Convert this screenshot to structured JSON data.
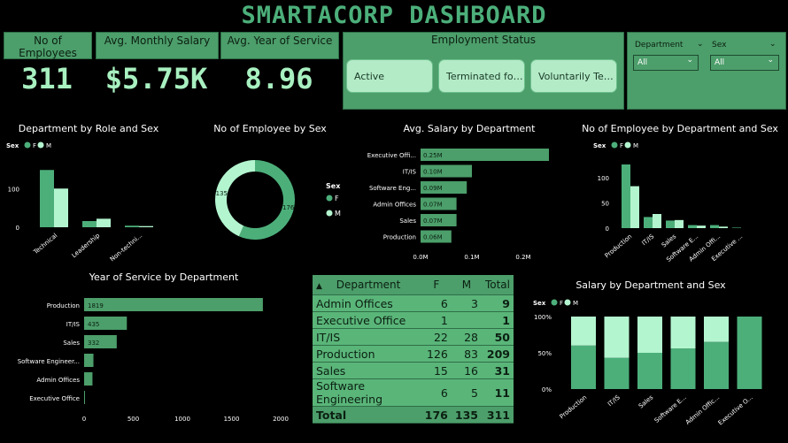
{
  "header": {
    "title": "SMARTACORP DASHBOARD"
  },
  "kpis": [
    {
      "label": "No of Employees",
      "value": "311"
    },
    {
      "label": "Avg. Monthly Salary",
      "value": "$5.75K"
    },
    {
      "label": "Avg. Year of Service",
      "value": "8.96"
    }
  ],
  "employment_status": {
    "title": "Employment Status",
    "options": [
      "Active",
      "Terminated for…",
      "Voluntarily Ter…"
    ]
  },
  "slicers": [
    {
      "label": "Department",
      "selected": "All"
    },
    {
      "label": "Sex",
      "selected": "All"
    }
  ],
  "colors": {
    "female": "#4caf7a",
    "male": "#b3f5cf",
    "bar": "#4c9e6a",
    "card": "#4c9e6a",
    "background": "#000000"
  },
  "chart_data": [
    {
      "id": "dept_role_sex",
      "type": "bar",
      "title": "Department by Role and Sex",
      "legend_title": "Sex",
      "legend": [
        "F",
        "M"
      ],
      "categories": [
        "Technical",
        "Leadership",
        "Non-techni..."
      ],
      "series": [
        {
          "name": "F",
          "values": [
            148,
            16,
            4
          ]
        },
        {
          "name": "M",
          "values": [
            100,
            22,
            3
          ]
        }
      ],
      "yticks": [
        "0",
        "100"
      ],
      "ylim": [
        0,
        160
      ]
    },
    {
      "id": "emp_by_sex",
      "type": "pie",
      "title": "No of Employee by Sex",
      "legend_title": "Sex",
      "legend": [
        "F",
        "M"
      ],
      "slices": [
        {
          "name": "F",
          "value": 176
        },
        {
          "name": "M",
          "value": 135
        }
      ]
    },
    {
      "id": "avg_salary_dept",
      "type": "bar",
      "orientation": "horizontal",
      "title": "Avg. Salary by Department",
      "categories": [
        "Executive Offi...",
        "IT/IS",
        "Software Eng...",
        "Admin Offices",
        "Sales",
        "Production"
      ],
      "values": [
        0.25,
        0.1,
        0.09,
        0.07,
        0.07,
        0.06
      ],
      "labels": [
        "0.25M",
        "0.10M",
        "0.09M",
        "0.07M",
        "0.07M",
        "0.06M"
      ],
      "xticks": [
        "0.0M",
        "0.1M",
        "0.2M"
      ],
      "xlim": [
        0,
        0.2
      ]
    },
    {
      "id": "emp_dept_sex",
      "type": "bar",
      "title": "No of Employee by Department and Sex",
      "legend_title": "Sex",
      "legend": [
        "F",
        "M"
      ],
      "categories": [
        "Production",
        "IT/IS",
        "Sales",
        "Software E...",
        "Admin Offi...",
        "Executive ..."
      ],
      "series": [
        {
          "name": "F",
          "values": [
            126,
            22,
            15,
            6,
            6,
            1
          ]
        },
        {
          "name": "M",
          "values": [
            83,
            28,
            16,
            5,
            3,
            0
          ]
        }
      ],
      "yticks": [
        "0",
        "50",
        "100"
      ],
      "ylim": [
        0,
        140
      ]
    },
    {
      "id": "yos_dept",
      "type": "bar",
      "orientation": "horizontal",
      "title": "Year of Service by Department",
      "categories": [
        "Production",
        "IT/IS",
        "Sales",
        "Software Engineer...",
        "Admin Offices",
        "Executive Office"
      ],
      "values": [
        1819,
        435,
        332,
        95,
        85,
        8
      ],
      "labels": [
        "1819",
        "435",
        "332",
        "",
        "",
        ""
      ],
      "xticks": [
        "0",
        "500",
        "1000",
        "1500",
        "2000"
      ],
      "xlim": [
        0,
        2000
      ]
    },
    {
      "id": "salary_dept_sex",
      "type": "bar",
      "stacked": "100%",
      "title": "Salary by Department and Sex",
      "legend_title": "Sex",
      "legend": [
        "F",
        "M"
      ],
      "categories": [
        "Production",
        "IT/IS",
        "Sales",
        "Software E...",
        "Admin Offic...",
        "Executive O..."
      ],
      "series": [
        {
          "name": "F",
          "values": [
            60,
            43,
            50,
            56,
            65,
            100
          ]
        },
        {
          "name": "M",
          "values": [
            40,
            57,
            50,
            44,
            35,
            0
          ]
        }
      ],
      "yticks": [
        "0%",
        "50%",
        "100%"
      ],
      "ylim": [
        0,
        100
      ]
    },
    {
      "id": "dept_matrix",
      "type": "table",
      "columns": [
        "Department",
        "F",
        "M",
        "Total"
      ],
      "rows": [
        [
          "Admin Offices",
          "6",
          "3",
          "9"
        ],
        [
          "Executive Office",
          "1",
          "",
          "1"
        ],
        [
          "IT/IS",
          "22",
          "28",
          "50"
        ],
        [
          "Production",
          "126",
          "83",
          "209"
        ],
        [
          "Sales",
          "15",
          "16",
          "31"
        ],
        [
          "Software Engineering",
          "6",
          "5",
          "11"
        ]
      ],
      "total": [
        "Total",
        "176",
        "135",
        "311"
      ]
    }
  ]
}
